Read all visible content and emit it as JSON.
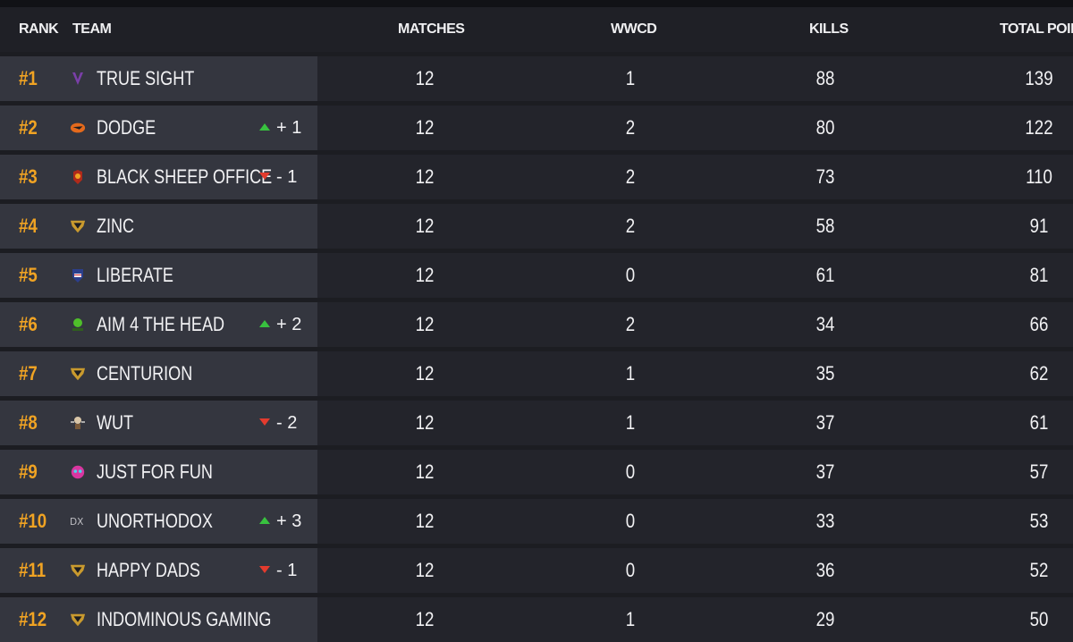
{
  "header": {
    "rank": "RANK",
    "team": "TEAM",
    "matches": "MATCHES",
    "wwcd": "WWCD",
    "kills": "KILLS",
    "total": "TOTAL POINTS"
  },
  "rows": [
    {
      "rank": "#1",
      "team": "TRUE SIGHT",
      "logo": "true-sight-logo-icon",
      "change": "",
      "dir": "",
      "matches": "12",
      "wwcd": "1",
      "kills": "88",
      "total": "139"
    },
    {
      "rank": "#2",
      "team": "DODGE",
      "logo": "dodge-logo-icon",
      "change": "+ 1",
      "dir": "up",
      "matches": "12",
      "wwcd": "2",
      "kills": "80",
      "total": "122"
    },
    {
      "rank": "#3",
      "team": "BLACK SHEEP OFFICE",
      "logo": "black-sheep-office-logo-icon",
      "change": "- 1",
      "dir": "down",
      "matches": "12",
      "wwcd": "2",
      "kills": "73",
      "total": "110"
    },
    {
      "rank": "#4",
      "team": "ZINC",
      "logo": "shield-logo-icon",
      "change": "",
      "dir": "",
      "matches": "12",
      "wwcd": "2",
      "kills": "58",
      "total": "91"
    },
    {
      "rank": "#5",
      "team": "LIBERATE",
      "logo": "liberate-logo-icon",
      "change": "",
      "dir": "",
      "matches": "12",
      "wwcd": "0",
      "kills": "61",
      "total": "81"
    },
    {
      "rank": "#6",
      "team": "AIM 4 THE HEAD",
      "logo": "aim-4-the-head-logo-icon",
      "change": "+ 2",
      "dir": "up",
      "matches": "12",
      "wwcd": "2",
      "kills": "34",
      "total": "66"
    },
    {
      "rank": "#7",
      "team": "CENTURION",
      "logo": "shield-logo-icon",
      "change": "",
      "dir": "",
      "matches": "12",
      "wwcd": "1",
      "kills": "35",
      "total": "62"
    },
    {
      "rank": "#8",
      "team": "WUT",
      "logo": "wut-logo-icon",
      "change": "- 2",
      "dir": "down",
      "matches": "12",
      "wwcd": "1",
      "kills": "37",
      "total": "61"
    },
    {
      "rank": "#9",
      "team": "JUST FOR FUN",
      "logo": "just-for-fun-logo-icon",
      "change": "",
      "dir": "",
      "matches": "12",
      "wwcd": "0",
      "kills": "37",
      "total": "57"
    },
    {
      "rank": "#10",
      "team": "UNORTHODOX",
      "logo": "unorthodox-logo-icon",
      "change": "+ 3",
      "dir": "up",
      "matches": "12",
      "wwcd": "0",
      "kills": "33",
      "total": "53"
    },
    {
      "rank": "#11",
      "team": "HAPPY DADS",
      "logo": "shield-logo-icon",
      "change": "- 1",
      "dir": "down",
      "matches": "12",
      "wwcd": "0",
      "kills": "36",
      "total": "52"
    },
    {
      "rank": "#12",
      "team": "INDOMINOUS GAMING",
      "logo": "shield-logo-icon",
      "change": "",
      "dir": "",
      "matches": "12",
      "wwcd": "1",
      "kills": "29",
      "total": "50"
    }
  ],
  "colors": {
    "accent": "#f0a323",
    "up": "#38c23f",
    "down": "#e33b2e",
    "row_left": "#34363f",
    "row_right": "#23242b"
  }
}
